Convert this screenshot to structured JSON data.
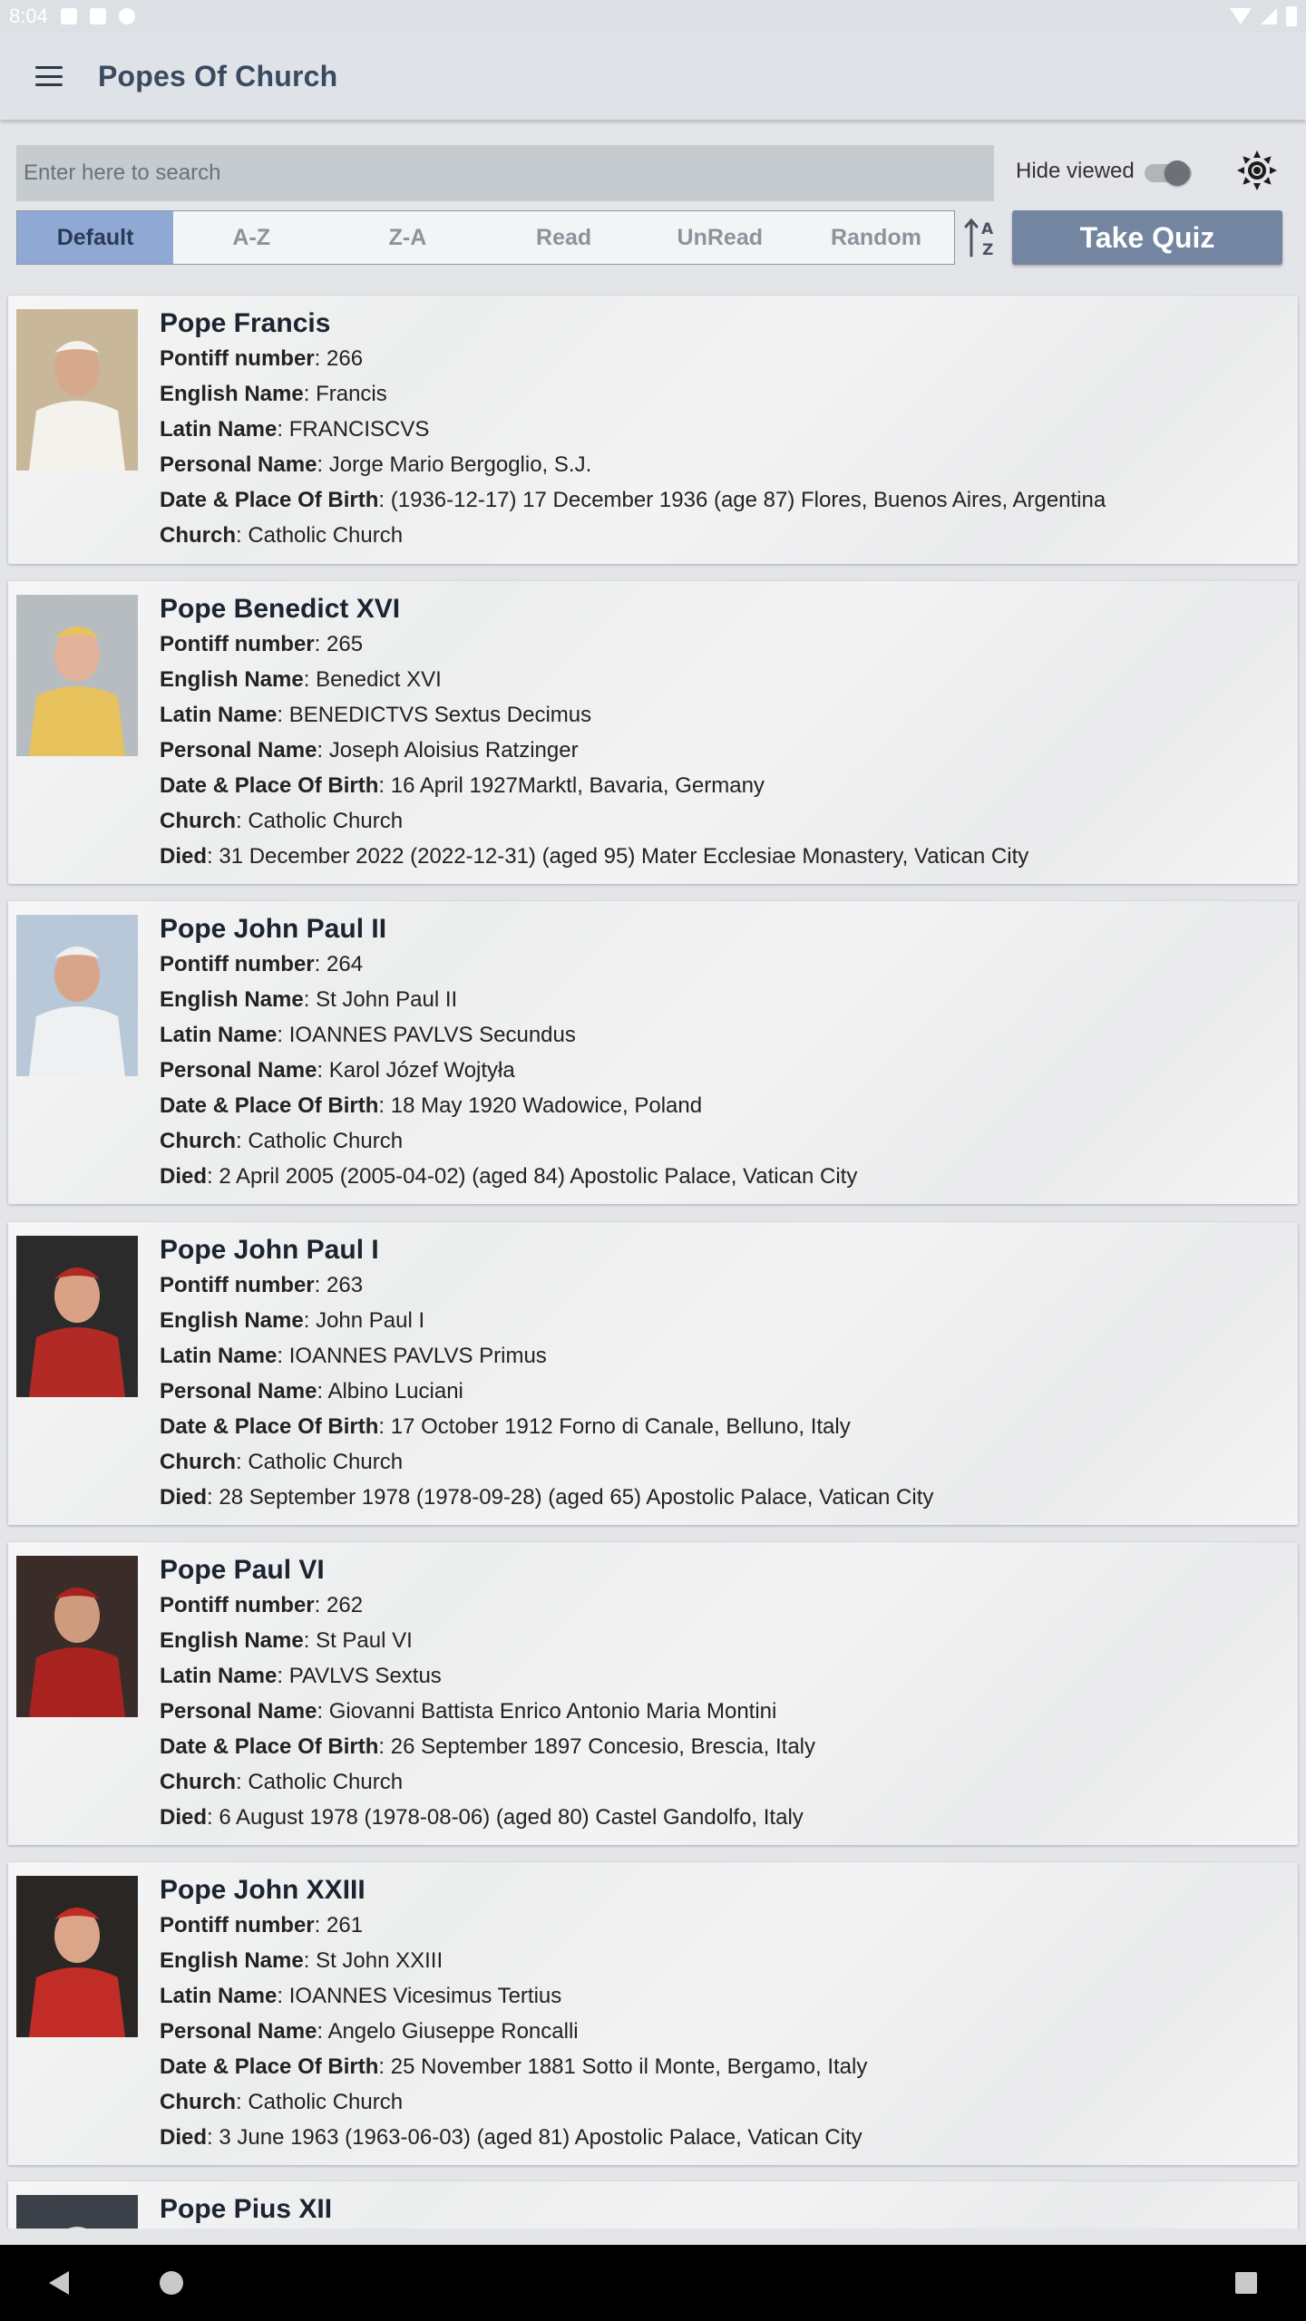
{
  "status_bar": {
    "time": "8:04"
  },
  "app_bar": {
    "title": "Popes Of Church"
  },
  "search": {
    "placeholder": "Enter here to search"
  },
  "hide_viewed": {
    "label": "Hide viewed",
    "enabled": false
  },
  "sort_tabs": [
    "Default",
    "A-Z",
    "Z-A",
    "Read",
    "UnRead",
    "Random"
  ],
  "active_sort": "Default",
  "quiz": {
    "label": "Take Quiz"
  },
  "field_labels": {
    "pontiff": "Pontiff number",
    "english": "English Name",
    "latin": "Latin Name",
    "personal": "Personal Name",
    "birth": "Date & Place Of Birth",
    "church": "Church",
    "died": "Died"
  },
  "popes": [
    {
      "name": "Pope Francis",
      "pontiff": "266",
      "english": "Francis",
      "latin": "FRANCISCVS",
      "personal": "Jorge Mario Bergoglio, S.J.",
      "birth": "(1936-12-17) 17 December 1936 (age 87) Flores, Buenos Aires, Argentina",
      "church": "Catholic Church",
      "died": null,
      "colors": {
        "bg": "#c9b79a",
        "robe": "#f4f2ec",
        "face": "#d7a98c"
      }
    },
    {
      "name": "Pope Benedict XVI",
      "pontiff": "265",
      "english": "Benedict XVI",
      "latin": "BENEDICTVS Sextus Decimus",
      "personal": "Joseph Aloisius Ratzinger",
      "birth": "16 April 1927Marktl, Bavaria, Germany",
      "church": "Catholic Church",
      "died": "31 December 2022 (2022-12-31) (aged 95) Mater Ecclesiae Monastery, Vatican City",
      "colors": {
        "bg": "#b7bcc0",
        "robe": "#e8c25c",
        "face": "#e2b29a"
      }
    },
    {
      "name": "Pope John Paul II",
      "pontiff": "264",
      "english": "St John Paul II",
      "latin": "IOANNES PAVLVS Secundus",
      "personal": "Karol Józef Wojtyła",
      "birth": "18 May 1920 Wadowice, Poland",
      "church": "Catholic Church",
      "died": "2 April 2005 (2005-04-02) (aged 84) Apostolic Palace, Vatican City",
      "colors": {
        "bg": "#b8c8d8",
        "robe": "#eef0f2",
        "face": "#d9a58a"
      }
    },
    {
      "name": "Pope John Paul I",
      "pontiff": "263",
      "english": "John Paul I",
      "latin": "IOANNES PAVLVS Primus",
      "personal": "Albino Luciani",
      "birth": "17 October 1912 Forno di Canale, Belluno, Italy",
      "church": "Catholic Church",
      "died": "28 September 1978 (1978-09-28) (aged 65) Apostolic Palace, Vatican City",
      "colors": {
        "bg": "#2b2b2b",
        "robe": "#b22a25",
        "face": "#d9a286"
      }
    },
    {
      "name": "Pope Paul VI",
      "pontiff": "262",
      "english": "St Paul VI",
      "latin": "PAVLVS Sextus",
      "personal": "Giovanni Battista Enrico Antonio Maria Montini",
      "birth": "26 September 1897 Concesio, Brescia, Italy",
      "church": "Catholic Church",
      "died": "6 August 1978 (1978-08-06) (aged 80) Castel Gandolfo, Italy",
      "colors": {
        "bg": "#3a2c28",
        "robe": "#a8231f",
        "face": "#cf9b7e"
      }
    },
    {
      "name": "Pope John XXIII",
      "pontiff": "261",
      "english": "St John XXIII",
      "latin": "IOANNES Vicesimus Tertius",
      "personal": "Angelo Giuseppe Roncalli",
      "birth": "25 November 1881 Sotto il Monte, Bergamo, Italy",
      "church": "Catholic Church",
      "died": "3 June 1963 (1963-06-03) (aged 81) Apostolic Palace, Vatican City",
      "colors": {
        "bg": "#2a2624",
        "robe": "#c12d26",
        "face": "#dba58a"
      }
    },
    {
      "name": "Pope Pius XII",
      "pontiff": null,
      "english": null,
      "latin": null,
      "personal": null,
      "birth": null,
      "church": null,
      "died": null,
      "colors": {
        "bg": "#3c4048",
        "robe": "#d8d8d8",
        "face": "#c8a08a"
      }
    }
  ]
}
